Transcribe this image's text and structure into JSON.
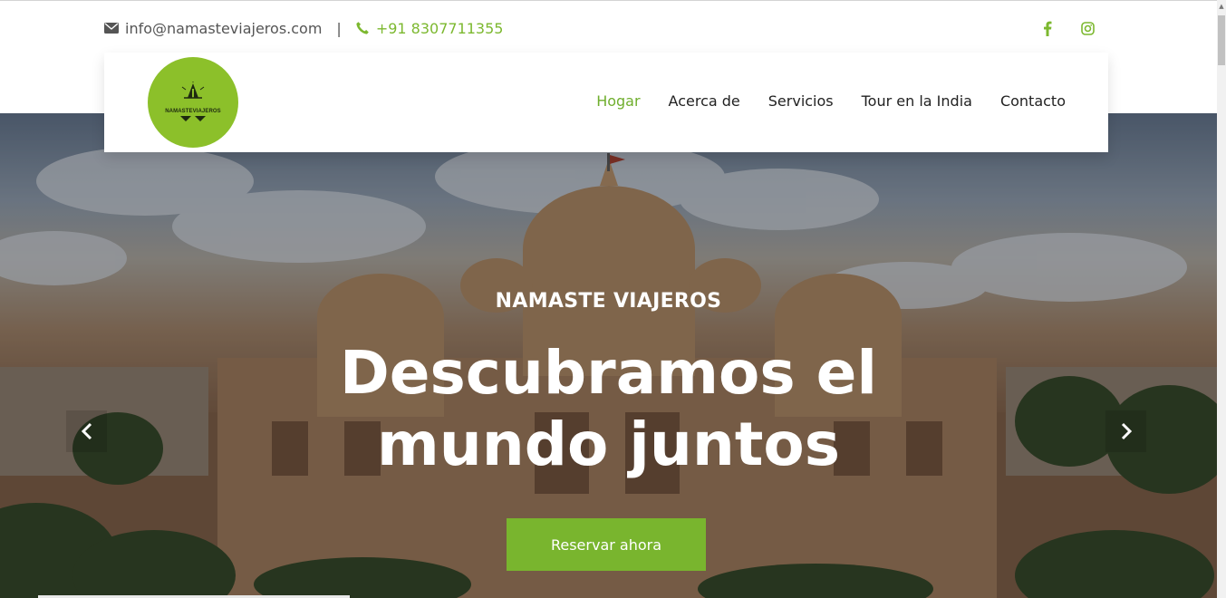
{
  "topbar": {
    "email": "info@namasteviajeros.com",
    "separator": "|",
    "phone": "+91 8307711355",
    "icons": {
      "email": "envelope-icon",
      "phone": "phone-icon",
      "facebook": "facebook-icon",
      "instagram": "instagram-icon"
    }
  },
  "brand": {
    "logo_text": "NAMASTEVIAJEROS"
  },
  "nav": {
    "items": [
      {
        "label": "Hogar",
        "active": true
      },
      {
        "label": "Acerca de",
        "active": false
      },
      {
        "label": "Servicios",
        "active": false
      },
      {
        "label": "Tour en la India",
        "active": false
      },
      {
        "label": "Contacto",
        "active": false
      }
    ]
  },
  "hero": {
    "subtitle": "NAMASTE VIAJEROS",
    "title_line1": "Descubramos el",
    "title_line2": "mundo juntos",
    "cta_label": "Reservar ahora",
    "prev_icon": "chevron-left-icon",
    "next_icon": "chevron-right-icon"
  },
  "colors": {
    "accent": "#79b52e",
    "active_nav": "#6fae2d",
    "logo_bg": "#8cc02a",
    "text": "#222222"
  }
}
